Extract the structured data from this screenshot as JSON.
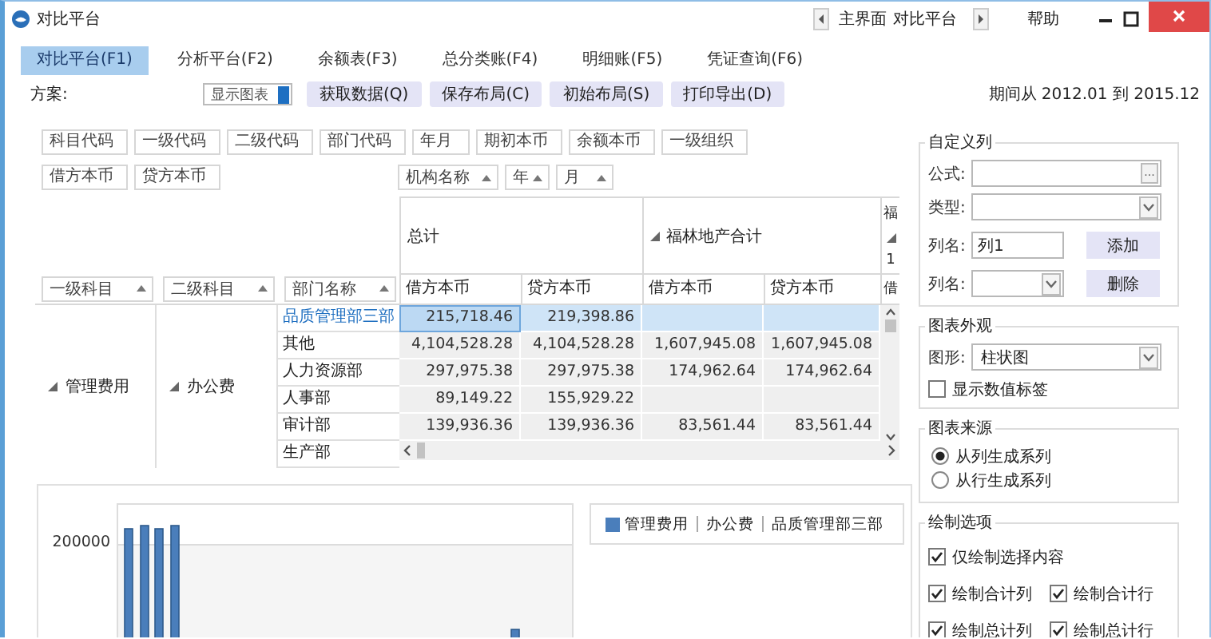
{
  "window": {
    "title": "对比平台",
    "breadcrumb": [
      "主界面",
      "对比平台"
    ],
    "help": "帮助"
  },
  "tabs": [
    {
      "label": "对比平台(F1)",
      "selected": true
    },
    {
      "label": "分析平台(F2)",
      "selected": false
    },
    {
      "label": "余额表(F3)",
      "selected": false
    },
    {
      "label": "总分类账(F4)",
      "selected": false
    },
    {
      "label": "明细账(F5)",
      "selected": false
    },
    {
      "label": "凭证查询(F6)",
      "selected": false
    }
  ],
  "toolbar": {
    "scheme_label": "方案:",
    "chart_toggle": {
      "label": "显示图表",
      "on": true
    },
    "buttons": [
      "获取数据(Q)",
      "保存布局(C)",
      "初始布局(S)",
      "打印导出(D)"
    ],
    "period": "期间从 2012.01 到 2015.12"
  },
  "field_list": [
    "科目代码",
    "一级代码",
    "二级代码",
    "部门代码",
    "年月",
    "期初本币",
    "余额本币",
    "一级组织"
  ],
  "data_fields": [
    "借方本币",
    "贷方本币"
  ],
  "column_fields": [
    "机构名称",
    "年",
    "月"
  ],
  "pivot": {
    "row_fields": [
      "一级科目",
      "二级科目",
      "部门名称"
    ],
    "column_groups": [
      {
        "label": "总计",
        "expandable": false
      },
      {
        "label": "福林地产合计",
        "expandable": true
      }
    ],
    "column_3": {
      "header": "福",
      "expandable": true,
      "value": "1",
      "measure": "借"
    },
    "measures": [
      "借方本币",
      "贷方本币",
      "借方本币",
      "贷方本币"
    ],
    "level1": {
      "label": "管理费用",
      "expanded": true
    },
    "level2": {
      "label": "办公费",
      "expanded": true
    },
    "rows": [
      {
        "label": "品质管理部三部",
        "selected": true,
        "total_values": [
          "215,718.46",
          "219,398.86"
        ]
      },
      {
        "label": "其他",
        "selected": false,
        "total_values": [
          "4,104,528.28",
          "4,104,528.28"
        ],
        "group_values": [
          "1,607,945.08",
          "1,607,945.08"
        ]
      },
      {
        "label": "人力资源部",
        "selected": false,
        "total_values": [
          "297,975.38",
          "297,975.38"
        ],
        "group_values": [
          "174,962.64",
          "174,962.64"
        ]
      },
      {
        "label": "人事部",
        "selected": false,
        "total_values": [
          "89,149.22",
          "155,929.22"
        ]
      },
      {
        "label": "审计部",
        "selected": false,
        "total_values": [
          "139,936.36",
          "139,936.36"
        ],
        "group_values": [
          "83,561.44",
          "83,561.44"
        ]
      },
      {
        "label": "生产部",
        "selected": false
      }
    ]
  },
  "chart": {
    "y_tick_labels": [
      "200000"
    ],
    "legend": [
      "管理费用",
      "办公费",
      "品质管理部三部"
    ]
  },
  "custom_column": {
    "title": "自定义列",
    "formula_label": "公式:",
    "browse": "...",
    "type_label": "类型:",
    "name_label": "列名:",
    "name_value": "列1",
    "add": "添加",
    "name2_label": "列名:",
    "delete": "删除"
  },
  "appearance": {
    "title": "图表外观",
    "shape_label": "图形:",
    "shape": "柱状图",
    "show_labels": {
      "label": "显示数值标签",
      "checked": false
    }
  },
  "source": {
    "title": "图表来源",
    "options": [
      {
        "label": "从列生成系列",
        "selected": true
      },
      {
        "label": "从行生成系列",
        "selected": false
      }
    ]
  },
  "draw_options": {
    "title": "绘制选项",
    "items": [
      {
        "label": "仅绘制选择内容",
        "checked": true
      },
      {
        "label": "绘制合计列",
        "checked": true
      },
      {
        "label": "绘制合计行",
        "checked": true
      },
      {
        "label": "绘制总计列",
        "checked": true
      },
      {
        "label": "绘制总计行",
        "checked": true
      }
    ]
  }
}
